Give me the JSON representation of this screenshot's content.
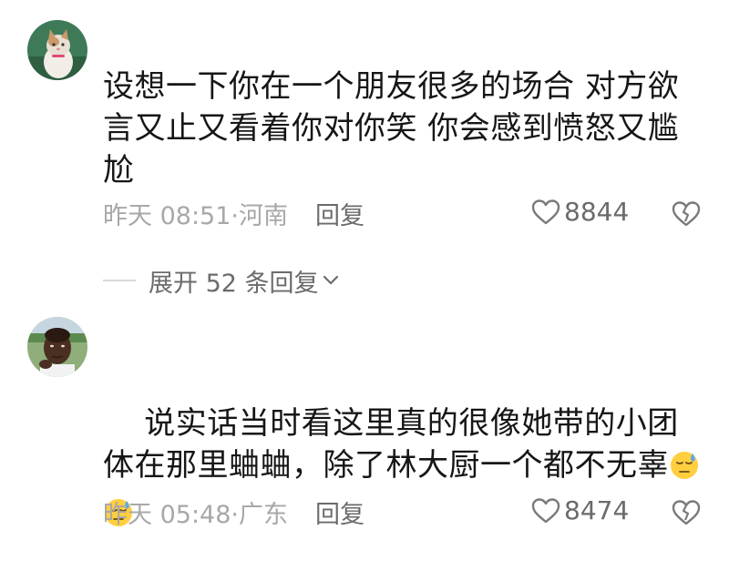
{
  "comments": [
    {
      "text": "设想一下你在一个朋友很多的场合 对方欲言又止又看着你对你笑 你会感到愤怒又尴尬",
      "time": "昨天 08:51",
      "location": "河南",
      "reply_label": "回复",
      "likes": "8844",
      "expand_label": "展开 52 条回复"
    },
    {
      "text": "说实话当时看这里真的很像她带的小团体在那里蛐蛐，除了林大厨一个都不无辜",
      "emojis": [
        "downcast-sweat-emoji",
        "downcast-sweat-emoji"
      ],
      "time": "昨天 05:48",
      "location": "广东",
      "reply_label": "回复",
      "likes": "8474"
    }
  ],
  "colors": {
    "text": "#161616",
    "meta": "#a3a3a3",
    "action": "#6b6b6b",
    "emoji": "#ffcf3f"
  },
  "icons": [
    "heart-icon",
    "broken-heart-icon",
    "chevron-down-icon"
  ]
}
